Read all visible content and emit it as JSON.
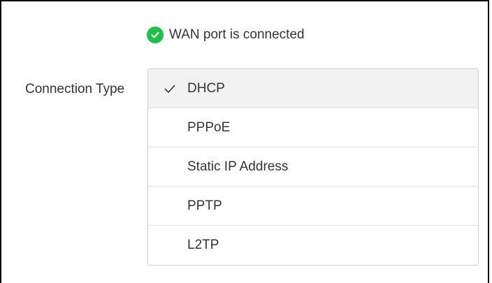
{
  "status": {
    "text": "WAN port is connected",
    "icon": "check-circle-icon",
    "color": "#1fbf4a"
  },
  "connection_type": {
    "label": "Connection Type",
    "selected": "DHCP",
    "options": [
      {
        "label": "DHCP",
        "selected": true
      },
      {
        "label": "PPPoE",
        "selected": false
      },
      {
        "label": "Static IP Address",
        "selected": false
      },
      {
        "label": "PPTP",
        "selected": false
      },
      {
        "label": "L2TP",
        "selected": false
      }
    ]
  }
}
